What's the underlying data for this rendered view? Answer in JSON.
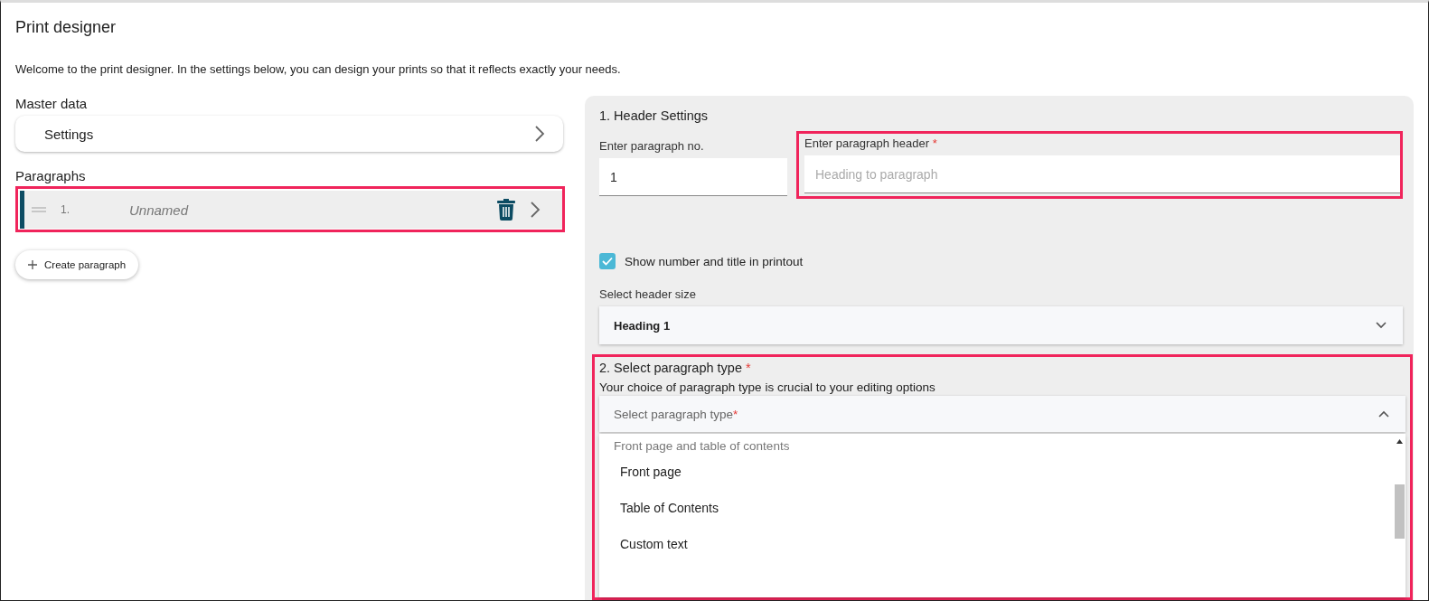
{
  "page": {
    "title": "Print designer",
    "intro": "Welcome to the print designer. In the settings below, you can design your prints so that it reflects exactly your needs."
  },
  "master_data": {
    "heading": "Master data",
    "items": [
      {
        "label": "Settings"
      }
    ]
  },
  "paragraphs": {
    "heading": "Paragraphs",
    "highlighted": true,
    "items": [
      {
        "number": "1.",
        "name": "Unnamed",
        "selected": true
      }
    ],
    "create_button": "Create paragraph"
  },
  "header_settings": {
    "title": "1. Header Settings",
    "number_field": {
      "label": "Enter paragraph no.",
      "value": "1"
    },
    "header_field": {
      "label": "Enter paragraph header",
      "required_mark": "*",
      "placeholder": "Heading to paragraph",
      "highlighted": true
    },
    "show_number_checkbox": {
      "label": "Show number and title in printout",
      "checked": true
    },
    "size_select": {
      "label": "Select header size",
      "value": "Heading 1"
    }
  },
  "paragraph_type": {
    "title": "2. Select paragraph type",
    "required_mark": "*",
    "highlighted": true,
    "description": "Your choice of paragraph type is crucial to your editing options",
    "select": {
      "placeholder": "Select paragraph type",
      "required_mark": "*",
      "expanded": true
    },
    "options": [
      {
        "kind": "group",
        "label": "Front page and table of contents"
      },
      {
        "kind": "option",
        "label": "Front page"
      },
      {
        "kind": "option",
        "label": "Table of Contents"
      },
      {
        "kind": "option",
        "label": "Custom text"
      }
    ]
  }
}
